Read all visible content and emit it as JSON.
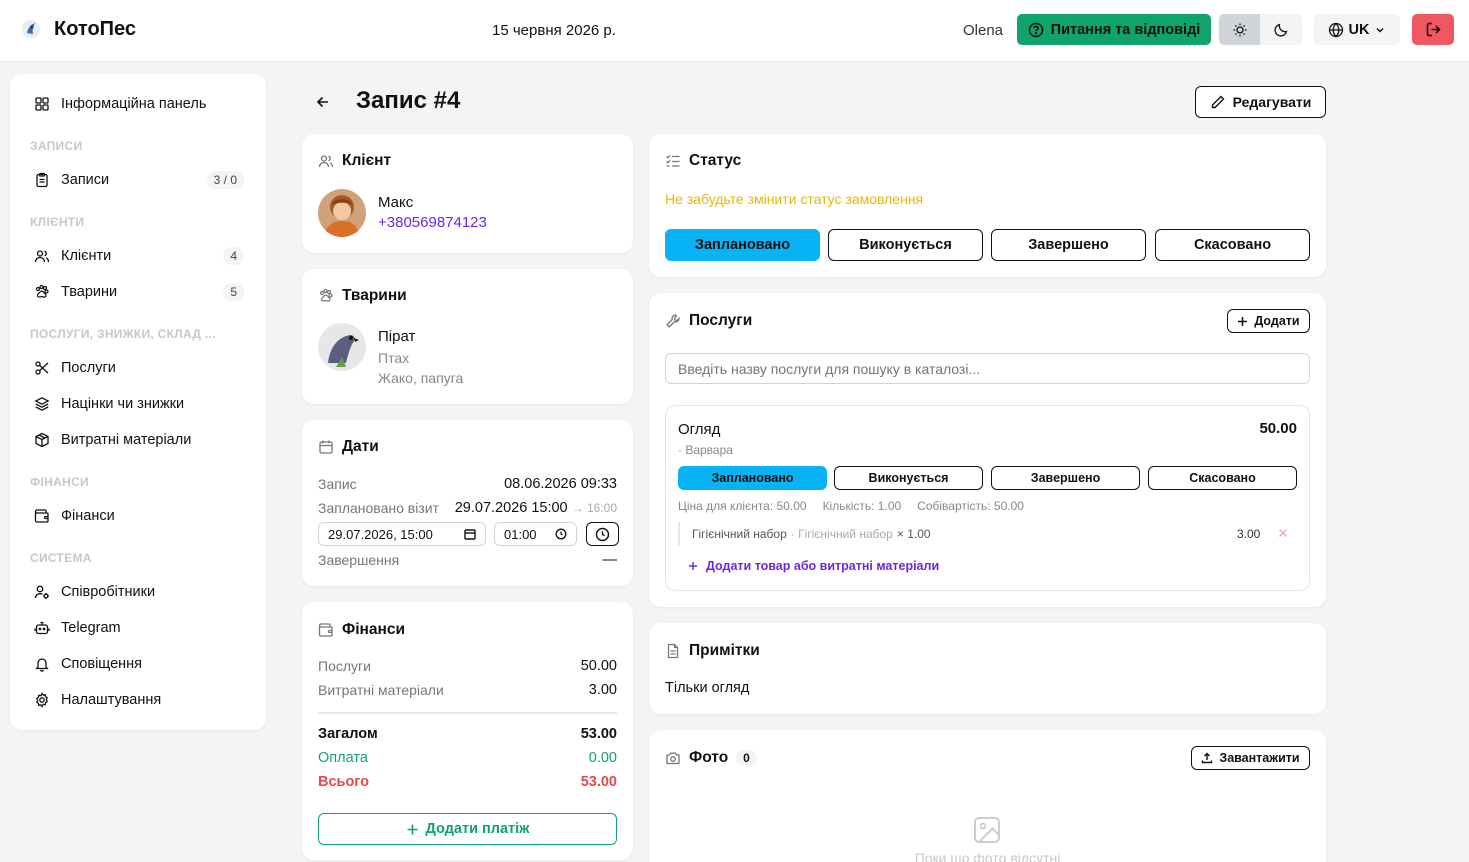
{
  "app": {
    "name": "КотоПес",
    "date": "15 червня 2026 р.",
    "user": "Olena",
    "help_label": "Питання та відповіді",
    "language": "UK"
  },
  "colors": {
    "accent_green": "#10a36b",
    "status_active": "#08b3f5",
    "danger": "#f0575e",
    "warning_text": "#e6b800",
    "link_purple": "#6d28d9",
    "payment_green": "#10a36b",
    "total_red": "#e5484d"
  },
  "sidebar": {
    "dashboard": "Інформаційна панель",
    "sections": {
      "records": "ЗАПИСИ",
      "clients": "КЛІЄНТИ",
      "services": "ПОСЛУГИ, ЗНИЖКИ, СКЛАД ...",
      "finance": "ФІНАНСИ",
      "system": "СИСТЕМА"
    },
    "items": {
      "records": {
        "label": "Записи",
        "count": "3 / 0"
      },
      "clients": {
        "label": "Клієнти",
        "count": "4"
      },
      "pets": {
        "label": "Тварини",
        "count": "5"
      },
      "services": {
        "label": "Послуги"
      },
      "markups": {
        "label": "Націнки чи знижки"
      },
      "supplies": {
        "label": "Витратні матеріали"
      },
      "finance": {
        "label": "Фінанси"
      },
      "staff": {
        "label": "Співробітники"
      },
      "telegram": {
        "label": "Telegram"
      },
      "notifications": {
        "label": "Сповіщення"
      },
      "settings": {
        "label": "Налаштування"
      }
    }
  },
  "page": {
    "title": "Запис #4",
    "edit_label": "Редагувати"
  },
  "client": {
    "header": "Клієнт",
    "name": "Макс",
    "phone": "+380569874123"
  },
  "pets": {
    "header": "Тварини",
    "name": "Пірат",
    "species": "Птах",
    "breed": "Жако, папуга"
  },
  "dates": {
    "header": "Дати",
    "record_label": "Запис",
    "record_value": "08.06.2026 09:33",
    "planned_label": "Заплановано візит",
    "planned_value": "29.07.2026 15:00",
    "planned_end": "→ 16:00",
    "datetime_input": "29.07.2026, 15:00",
    "duration_input": "01:00",
    "completion_label": "Завершення",
    "completion_value": "—"
  },
  "finance": {
    "header": "Фінанси",
    "services_label": "Послуги",
    "services_value": "50.00",
    "supplies_label": "Витратні матеріали",
    "supplies_value": "3.00",
    "total_label": "Загалом",
    "total_value": "53.00",
    "paid_label": "Оплата",
    "paid_value": "0.00",
    "due_label": "Всього",
    "due_value": "53.00",
    "add_payment": "Додати платіж"
  },
  "status": {
    "header": "Статус",
    "warning": "Не забудьте змінити статус замовлення",
    "options": [
      "Заплановано",
      "Виконується",
      "Завершено",
      "Скасовано"
    ],
    "selected": "Заплановано"
  },
  "services": {
    "header": "Послуги",
    "add_label": "Додати",
    "search_placeholder": "Введіть назву послуги для пошуку в каталозі...",
    "item": {
      "name": "Огляд",
      "price": "50.00",
      "staff": "· Варвара",
      "statuses": [
        "Заплановано",
        "Виконується",
        "Завершено",
        "Скасовано"
      ],
      "client_price": "Ціна для клієнта: 50.00",
      "quantity": "Кількість: 1.00",
      "cost": "Собівартість: 50.00",
      "supply": {
        "name": "Гігієнічний набор",
        "sub": "· Гігієнічний набор",
        "qty": "× 1.00",
        "amount": "3.00"
      },
      "add_supply": "Додати товар або витратні матеріали"
    }
  },
  "notes": {
    "header": "Примітки",
    "text": "Тільки огляд"
  },
  "photos": {
    "header": "Фото",
    "count": "0",
    "upload_label": "Завантажити",
    "empty": "Поки що фото відсутні"
  }
}
